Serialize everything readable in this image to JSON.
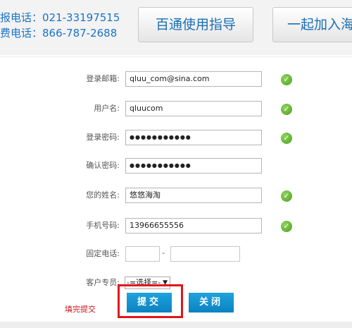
{
  "header": {
    "phone1": "报电话：021-33197515",
    "phone2": "费电话：866-787-2688",
    "guide_button": "百通使用指导",
    "join_button": "一起加入海"
  },
  "form": {
    "email": {
      "label": "登录邮箱:",
      "value": "qluu_com@sina.com",
      "valid": true
    },
    "username": {
      "label": "用户名:",
      "value": "qluucom",
      "valid": true
    },
    "password": {
      "label": "登录密码:",
      "value": "●●●●●●●●●●●",
      "valid": true
    },
    "confirm_password": {
      "label": "确认密码:",
      "value": "●●●●●●●●●●●"
    },
    "name": {
      "label": "您的姓名:",
      "value": "悠悠海淘",
      "valid": true
    },
    "mobile": {
      "label": "手机号码:",
      "value": "13966655556",
      "valid": true
    },
    "landline": {
      "label": "固定电话:",
      "separator": "-"
    },
    "rep": {
      "label": "客户专员:",
      "selected": "-=选择=-"
    }
  },
  "actions": {
    "submit": "提交",
    "close": "关闭",
    "hint": "填完提交"
  },
  "colors": {
    "accent": "#0a82c2",
    "highlight": "#e0151b",
    "success": "#4c9f21"
  },
  "icons": {
    "valid": "check-circle-icon",
    "dropdown": "chevron-down-icon"
  }
}
